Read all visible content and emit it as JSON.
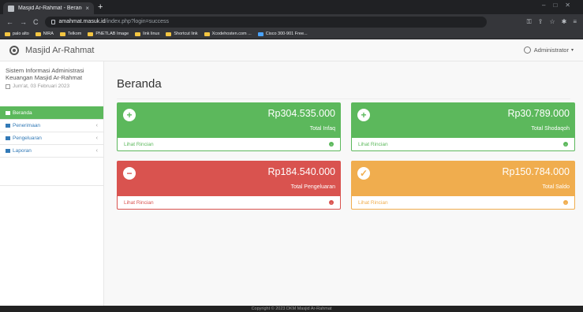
{
  "browser": {
    "tab_title": "Masjid Ar-Rahmat - Beranda",
    "tab_close": "×",
    "new_tab": "+",
    "url_host": "amahmat.masuk.id",
    "url_path": "/index.php?login=success",
    "nav_back": "←",
    "nav_forward": "→",
    "nav_reload": "C",
    "bookmarks": [
      "palo alto",
      "NIRA",
      "Telkom",
      "PNETLAB Image",
      "link linux",
      "Shortcut link",
      "Xcodehosten.com ...",
      "Cisco 300-901 Free..."
    ]
  },
  "header": {
    "brand": "Masjid Ar-Rahmat",
    "user": "Administrator",
    "caret": "▾"
  },
  "sidebar": {
    "info_line1": "Sistem Informasi Administrasi",
    "info_line2": "Keuangan Masjid Ar-Rahmat",
    "date": "Jum'at, 03 Februari 2023",
    "items": [
      {
        "label": "Beranda",
        "chevron": ""
      },
      {
        "label": "Penerimaan",
        "chevron": "‹"
      },
      {
        "label": "Pengeluaran",
        "chevron": "‹"
      },
      {
        "label": "Laporan",
        "chevron": "‹"
      }
    ]
  },
  "main": {
    "page_title": "Beranda",
    "cards": [
      {
        "symbol": "+",
        "amount": "Rp304.535.000",
        "label": "Total Infaq",
        "link": "Lihat Rincian",
        "color": "#5cb85c"
      },
      {
        "symbol": "+",
        "amount": "Rp30.789.000",
        "label": "Total Shodaqoh",
        "link": "Lihat Rincian",
        "color": "#5cb85c"
      },
      {
        "symbol": "−",
        "amount": "Rp184.540.000",
        "label": "Total Pengeluaran",
        "link": "Lihat Rincian",
        "color": "#d9534f"
      },
      {
        "symbol": "✓",
        "amount": "Rp150.784.000",
        "label": "Total Saldo",
        "link": "Lihat Rincian",
        "color": "#f0ad4e"
      }
    ],
    "arrow": "›"
  },
  "footer": {
    "text": "Copyright © 2023 DKM Masjid Ar-Rahmat"
  }
}
